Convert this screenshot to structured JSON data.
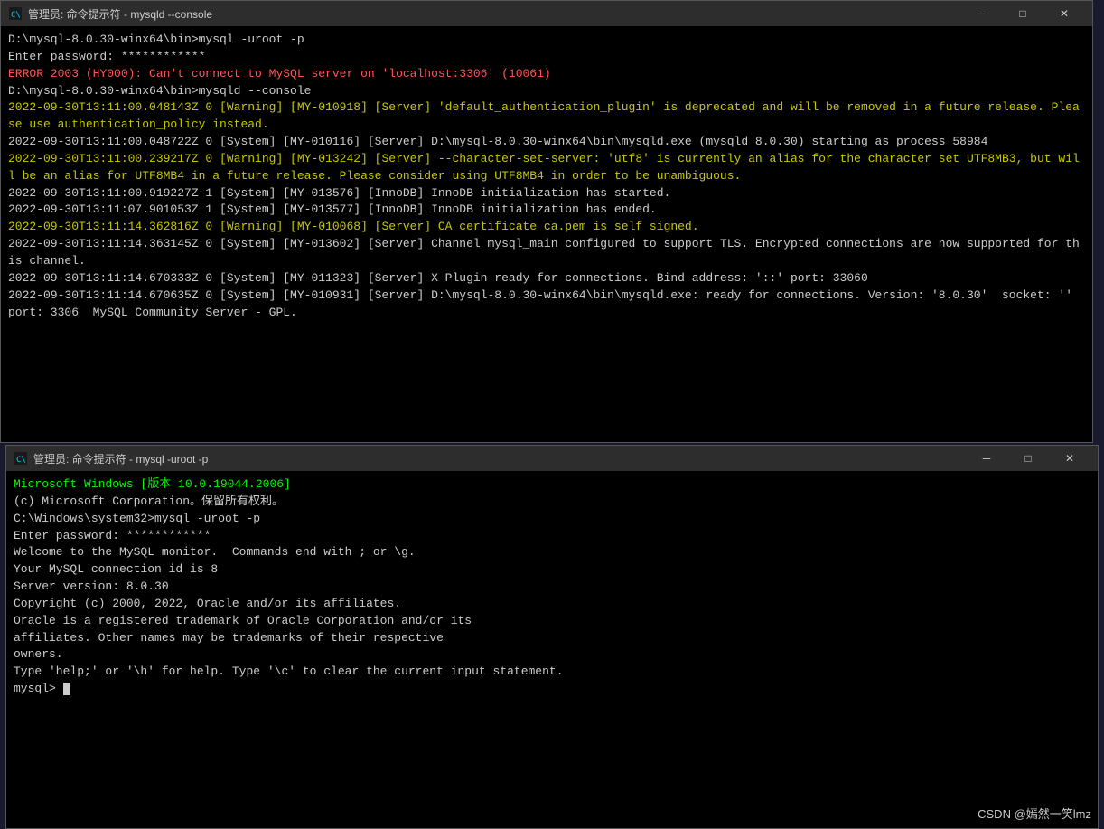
{
  "window1": {
    "title": "管理员: 命令提示符 - mysqld  --console",
    "lines": [
      {
        "text": "D:\\mysql-8.0.30-winx64\\bin>mysql -uroot -p",
        "style": "white"
      },
      {
        "text": "Enter password: ************",
        "style": "white"
      },
      {
        "text": "ERROR 2003 (HY000): Can't connect to MySQL server on 'localhost:3306' (10061)",
        "style": "red"
      },
      {
        "text": "",
        "style": "white"
      },
      {
        "text": "D:\\mysql-8.0.30-winx64\\bin>mysqld --console",
        "style": "white"
      },
      {
        "text": "2022-09-30T13:11:00.048143Z 0 [Warning] [MY-010918] [Server] 'default_authentication_plugin' is deprecated and will be removed in a future release. Please use authentication_policy instead.",
        "style": "yellow"
      },
      {
        "text": "2022-09-30T13:11:00.048722Z 0 [System] [MY-010116] [Server] D:\\mysql-8.0.30-winx64\\bin\\mysqld.exe (mysqld 8.0.30) starting as process 58984",
        "style": "white"
      },
      {
        "text": "2022-09-30T13:11:00.239217Z 0 [Warning] [MY-013242] [Server] --character-set-server: 'utf8' is currently an alias for the character set UTF8MB3, but will be an alias for UTF8MB4 in a future release. Please consider using UTF8MB4 in order to be unambiguous.",
        "style": "yellow"
      },
      {
        "text": "2022-09-30T13:11:00.919227Z 1 [System] [MY-013576] [InnoDB] InnoDB initialization has started.",
        "style": "white"
      },
      {
        "text": "2022-09-30T13:11:07.901053Z 1 [System] [MY-013577] [InnoDB] InnoDB initialization has ended.",
        "style": "white"
      },
      {
        "text": "2022-09-30T13:11:14.362816Z 0 [Warning] [MY-010068] [Server] CA certificate ca.pem is self signed.",
        "style": "yellow"
      },
      {
        "text": "2022-09-30T13:11:14.363145Z 0 [System] [MY-013602] [Server] Channel mysql_main configured to support TLS. Encrypted connections are now supported for this channel.",
        "style": "white"
      },
      {
        "text": "2022-09-30T13:11:14.670333Z 0 [System] [MY-011323] [Server] X Plugin ready for connections. Bind-address: '::' port: 33060",
        "style": "white"
      },
      {
        "text": "2022-09-30T13:11:14.670635Z 0 [System] [MY-010931] [Server] D:\\mysql-8.0.30-winx64\\bin\\mysqld.exe: ready for connections. Version: '8.0.30'  socket: ''  port: 3306  MySQL Community Server - GPL.",
        "style": "white"
      }
    ]
  },
  "window2": {
    "title": "管理员: 命令提示符 - mysql -uroot -p",
    "lines": [
      {
        "text": "Microsoft Windows [版本 10.0.19044.2006]",
        "style": "green"
      },
      {
        "text": "(c) Microsoft Corporation。保留所有权利。",
        "style": "white"
      },
      {
        "text": "",
        "style": "white"
      },
      {
        "text": "C:\\Windows\\system32>mysql -uroot -p",
        "style": "white"
      },
      {
        "text": "Enter password: ************",
        "style": "white"
      },
      {
        "text": "Welcome to the MySQL monitor.  Commands end with ; or \\g.",
        "style": "white"
      },
      {
        "text": "Your MySQL connection id is 8",
        "style": "white"
      },
      {
        "text": "Server version: 8.0.30",
        "style": "white"
      },
      {
        "text": "",
        "style": "white"
      },
      {
        "text": "Copyright (c) 2000, 2022, Oracle and/or its affiliates.",
        "style": "white"
      },
      {
        "text": "",
        "style": "white"
      },
      {
        "text": "Oracle is a registered trademark of Oracle Corporation and/or its",
        "style": "white"
      },
      {
        "text": "affiliates. Other names may be trademarks of their respective",
        "style": "white"
      },
      {
        "text": "owners.",
        "style": "white"
      },
      {
        "text": "",
        "style": "white"
      },
      {
        "text": "Type 'help;' or '\\h' for help. Type '\\c' to clear the current input statement.",
        "style": "white"
      },
      {
        "text": "",
        "style": "white"
      },
      {
        "text": "mysql> _",
        "style": "white"
      }
    ]
  },
  "watermark": {
    "text": "CSDN @嫣然一笑lmz"
  },
  "controls": {
    "minimize": "─",
    "maximize": "□",
    "close": "✕"
  }
}
